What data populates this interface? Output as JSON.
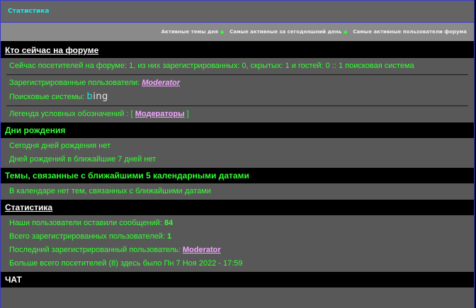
{
  "header": {
    "title": "Статистика"
  },
  "nav": [
    {
      "label": "Активные темы дня"
    },
    {
      "label": "Самые активные за сегодняшний день"
    },
    {
      "label": "Самые активные пользователи форума"
    }
  ],
  "online": {
    "heading": "Кто сейчас на форуме",
    "visitors_line": "Сейчас посетителей на форуме: 1, из них зарегистрированных: 0, скрытых: 1 и гостей: 0 :: 1 поисковая система",
    "registered_label": "Зарегистрированные пользователи:",
    "registered_user": "Moderator",
    "search_label": "Поисковые системы:",
    "search_engine_first": "b",
    "search_engine_rest": "ing",
    "legend_label": "Легенда условных обозначений : [",
    "legend_item": "Модераторы",
    "legend_close": "]"
  },
  "birthdays": {
    "heading": "Дни рождения",
    "today": "Сегодня дней рождения нет",
    "week": "Дней рождений в ближайшие 7 дней нет"
  },
  "calendar": {
    "heading": "Темы, связанные с ближайшими 5 календарными датами",
    "text": "В календаре нет тем, связанных с ближайшими датами"
  },
  "stats": {
    "heading": "Статистика",
    "posts_label": "Наши пользователи оставили сообщений:",
    "posts_value": "84",
    "users_label": "Всего зарегистрированных пользователей:",
    "users_value": "1",
    "last_label": "Последний зарегистрированный пользователь:",
    "last_user": "Moderator",
    "record": "Больше всего посетителей (8) здесь было Пн 7 Ноя 2022 - 17:59"
  },
  "chat": {
    "heading": "ЧАТ"
  },
  "colors": {
    "text": "#33ff33",
    "title": "#22e5e5",
    "moderator": "#f2a7ff",
    "panel": "#585858",
    "header_bar": "#000000"
  }
}
